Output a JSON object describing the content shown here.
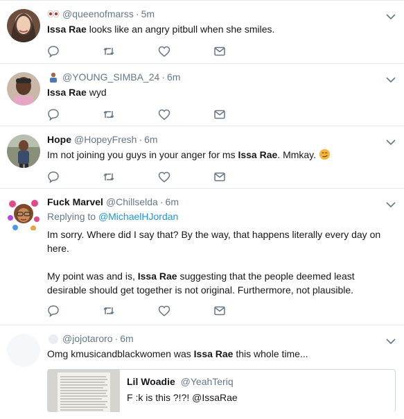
{
  "tweets": [
    {
      "handle": "@queenofmarss",
      "time": "5m",
      "text_bold": "Issa Rae",
      "text_rest": " looks like an angry pitbull when she smiles."
    },
    {
      "handle": "@YOUNG_SIMBA_24",
      "time": "6m",
      "text_bold": "Issa Rae",
      "text_rest": " wyd"
    },
    {
      "name": "Hope",
      "handle": "@HopeyFresh",
      "time": "6m",
      "text_pre": "Im not joining you guys in your anger for ms ",
      "text_bold": "Issa Rae",
      "text_post": ".  Mmkay."
    },
    {
      "name": "Fuck Marvel",
      "handle": "@Chillselda",
      "time": "6m",
      "replying_prefix": "Replying to ",
      "replying_to": "@MichaelHJordan",
      "para1": "Im sorry. Where did I say that? By the way, that happens literally every day on here.",
      "para2_pre": "My point was and is, ",
      "para2_bold": "Issa Rae",
      "para2_post": " suggesting that the people deemed least desirable should get together is not original. Furthermore, not plausible."
    },
    {
      "handle": "@jojotaroro",
      "time": "6m",
      "text_pre": "Omg kmusicandblackwomen was ",
      "text_bold": "Issa Rae",
      "text_post": " this whole time...",
      "quote": {
        "name": "Lil Woadie",
        "handle": "@YeahTeriq",
        "text": "F  :k is this ?!?! @IssaRae"
      }
    }
  ],
  "colors": {
    "text": "#14171a",
    "muted": "#657786",
    "link": "#1b95e0",
    "divider": "#e6ecf0"
  },
  "icons": [
    "reply-icon",
    "retweet-icon",
    "like-icon",
    "message-icon",
    "chevron-down-icon"
  ]
}
